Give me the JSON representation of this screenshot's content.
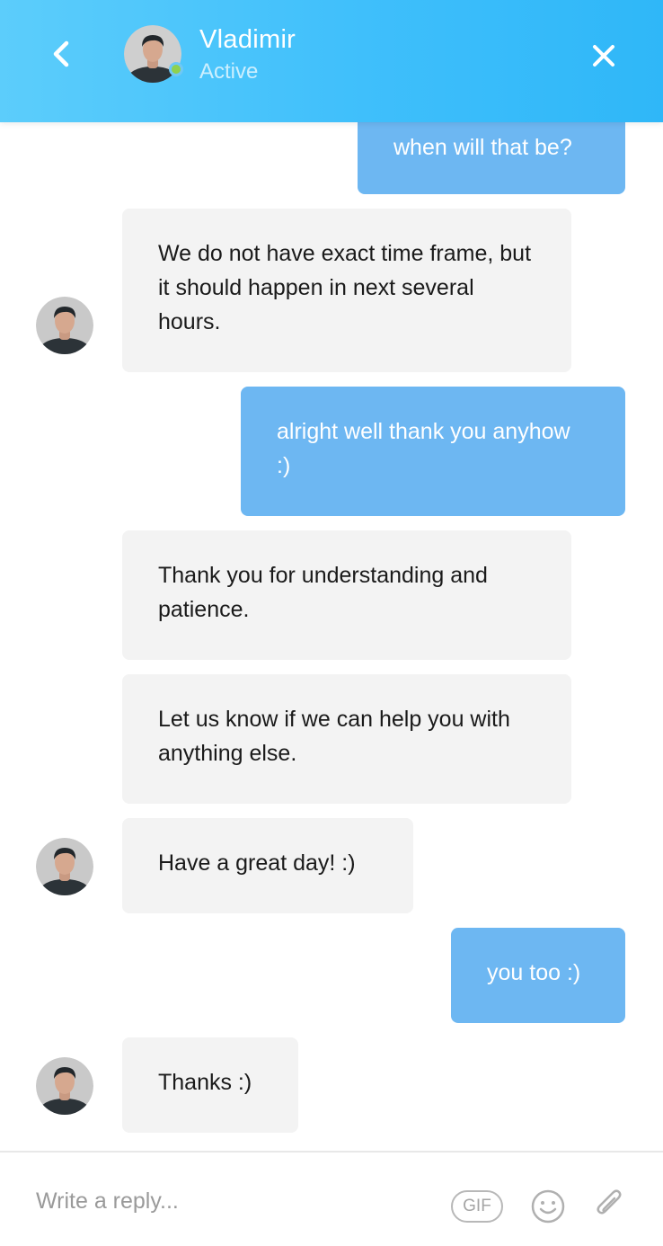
{
  "header": {
    "contact_name": "Vladimir",
    "contact_status": "Active",
    "back_icon": "chevron-left-icon",
    "close_icon": "close-icon",
    "presence_color": "#8fd14f",
    "gradient_colors": [
      "#5ccdfb",
      "#2fb7f8"
    ]
  },
  "messages": [
    {
      "sender": "user",
      "text": "when will that be?"
    },
    {
      "sender": "agent",
      "text": "We do not have exact time frame, but it should happen in next several hours."
    },
    {
      "sender": "user",
      "text": "alright well thank you anyhow :)"
    },
    {
      "sender": "agent",
      "text": "Thank you for understanding and patience."
    },
    {
      "sender": "agent",
      "text": "Let us know if we can help you with anything else."
    },
    {
      "sender": "agent",
      "text": "Have a great day! :)"
    },
    {
      "sender": "user",
      "text": "you too :)"
    },
    {
      "sender": "agent",
      "text": "Thanks :)"
    }
  ],
  "composer": {
    "placeholder": "Write a reply...",
    "gif_label": "GIF",
    "emoji_icon": "smiley-icon",
    "attach_icon": "paperclip-icon"
  },
  "colors": {
    "incoming_bubble": "#f3f3f3",
    "outgoing_bubble": "#6db7f2"
  }
}
